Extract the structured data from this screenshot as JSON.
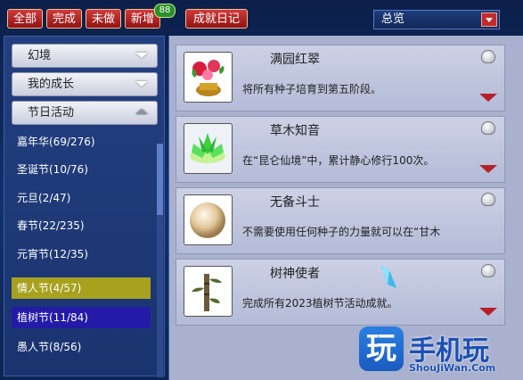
{
  "top_buttons": {
    "all": "全部",
    "done": "完成",
    "undone": "未做",
    "new": "新增",
    "new_count": "88",
    "diary": "成就日记"
  },
  "filter_select": {
    "value": "总览"
  },
  "sidebar": {
    "categories": [
      {
        "label": "幻境",
        "state": "collapsed"
      },
      {
        "label": "我的成长",
        "state": "collapsed"
      },
      {
        "label": "节日活动",
        "state": "expanded"
      }
    ],
    "items": [
      {
        "label": "嘉年华(69/276)"
      },
      {
        "label": "圣诞节(10/76)"
      },
      {
        "label": "元旦(2/47)"
      },
      {
        "label": "春节(22/235)"
      },
      {
        "label": "元宵节(12/35)"
      },
      {
        "label": "情人节(4/57)"
      },
      {
        "label": "植树节(11/84)"
      },
      {
        "label": "愚人节(8/56)"
      }
    ]
  },
  "achievements": [
    {
      "title": "满园红翠",
      "desc": "将所有种子培育到第五阶段。",
      "icon": "flower-pot-icon"
    },
    {
      "title": "草木知音",
      "desc": "在“昆仑仙境”中，累计静心修行100次。",
      "icon": "lotus-icon"
    },
    {
      "title": "无备斗士",
      "desc": "不需要使用任何种子的力量就可以在“甘木",
      "icon": "pearl-icon"
    },
    {
      "title": "树神使者",
      "desc": "完成所有2023植树节活动成就。",
      "icon": "bamboo-icon"
    }
  ],
  "watermark": {
    "logo_char": "玩",
    "brand": "手机玩",
    "url": "ShouJiWan.Com"
  },
  "colors": {
    "accent_red": "#b4202c",
    "highlight_valentine": "#a7a11e",
    "highlight_arbor": "#231ba8",
    "badge_green": "#2f8f2a"
  }
}
